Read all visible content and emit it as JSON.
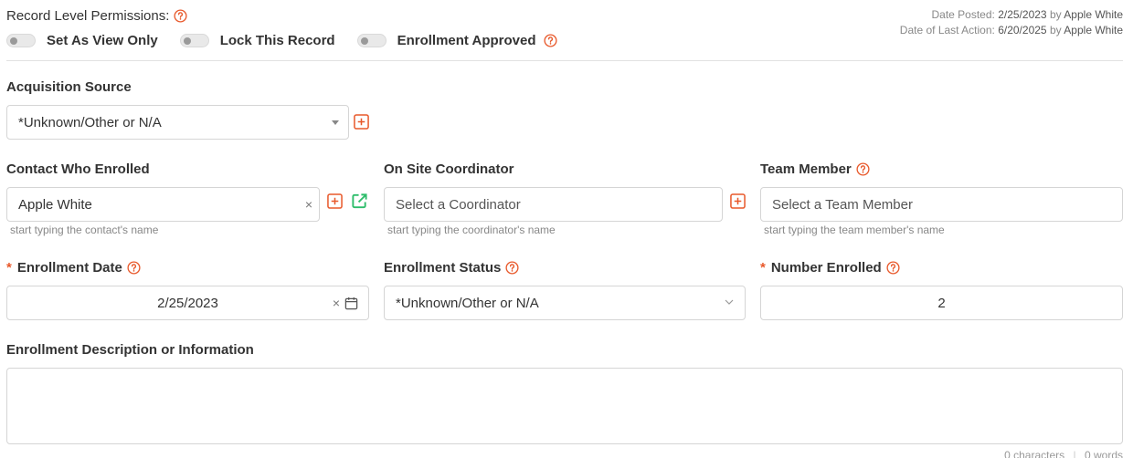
{
  "permissions": {
    "label": "Record Level Permissions:",
    "toggles": [
      {
        "label": "Set As View Only",
        "checked": false
      },
      {
        "label": "Lock This Record",
        "checked": false
      },
      {
        "label": "Enrollment Approved",
        "checked": false
      }
    ]
  },
  "meta": {
    "posted_label": "Date Posted:",
    "posted_date": "2/25/2023",
    "posted_by_word": "by",
    "posted_by": "Apple White",
    "last_action_label": "Date of Last Action:",
    "last_action_date": "6/20/2025",
    "last_action_by_word": "by",
    "last_action_by": "Apple White"
  },
  "acquisition": {
    "label": "Acquisition Source",
    "value": "*Unknown/Other or N/A"
  },
  "contact": {
    "label": "Contact Who Enrolled",
    "value": "Apple White",
    "hint": "start typing the contact's name"
  },
  "coordinator": {
    "label": "On Site Coordinator",
    "placeholder": "Select a Coordinator",
    "hint": "start typing the coordinator's name"
  },
  "team_member": {
    "label": "Team Member",
    "placeholder": "Select a Team Member",
    "hint": "start typing the team member's name"
  },
  "enrollment_date": {
    "required_mark": "*",
    "label": "Enrollment Date",
    "value": "2/25/2023"
  },
  "enrollment_status": {
    "label": "Enrollment Status",
    "value": "*Unknown/Other or N/A"
  },
  "number_enrolled": {
    "required_mark": "*",
    "label": "Number Enrolled",
    "value": "2"
  },
  "description": {
    "label": "Enrollment Description or Information",
    "value": "",
    "char_count": "0 characters",
    "separator": "|",
    "word_count": "0 words"
  },
  "colors": {
    "accent": "#e8582a",
    "link_green": "#2ebd6b",
    "border": "#d5d5d5"
  },
  "icons": {
    "help": "question-circle-icon",
    "add": "plus-square-icon",
    "open": "external-link-icon",
    "calendar": "calendar-icon",
    "clear": "close-icon",
    "dropdown": "chevron-down-icon"
  }
}
